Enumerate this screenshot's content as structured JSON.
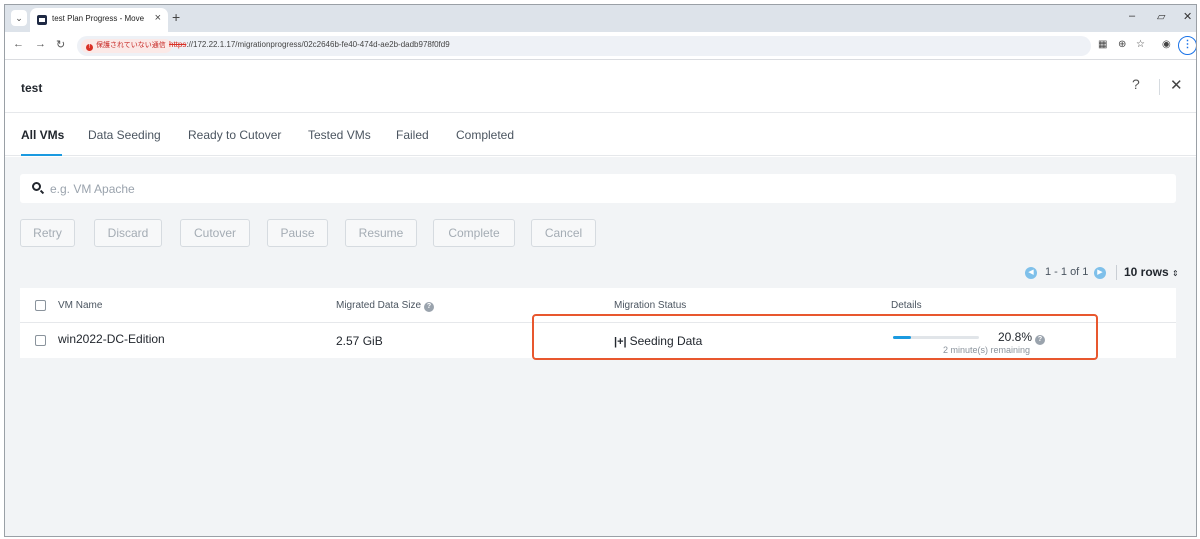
{
  "browser": {
    "tab_title": "test Plan Progress - Move",
    "tab_close": "×",
    "new_tab": "+",
    "security_label": "保護されていない通信",
    "url_scheme": "https",
    "url_rest": "://172.22.1.17/migrationprogress/02c2646b-fe40-474d-ae2b-dadb978f0fd9",
    "minimize": "–",
    "restore": "▱",
    "close": "✕",
    "menu": "⋮"
  },
  "header": {
    "title": "test",
    "help": "?",
    "close": "✕"
  },
  "tabs": [
    "All VMs",
    "Data Seeding",
    "Ready to Cutover",
    "Tested VMs",
    "Failed",
    "Completed"
  ],
  "search": {
    "placeholder": "e.g. VM Apache"
  },
  "actions": [
    "Retry",
    "Discard",
    "Cutover",
    "Pause",
    "Resume",
    "Complete",
    "Cancel"
  ],
  "pagination": {
    "range": "1 - 1 of 1",
    "rows": "10 rows"
  },
  "table": {
    "columns": [
      "VM Name",
      "Migrated Data Size",
      "Migration Status",
      "Details"
    ],
    "rows": [
      {
        "vm_name": "win2022-DC-Edition",
        "size": "2.57 GiB",
        "status": "Seeding Data",
        "status_icon": "|+|",
        "progress": 0.208,
        "percent": "20.8%",
        "remaining": "2 minute(s) remaining"
      }
    ]
  },
  "colors": {
    "accent": "#1b9ae0",
    "highlight": "#e8572e"
  }
}
